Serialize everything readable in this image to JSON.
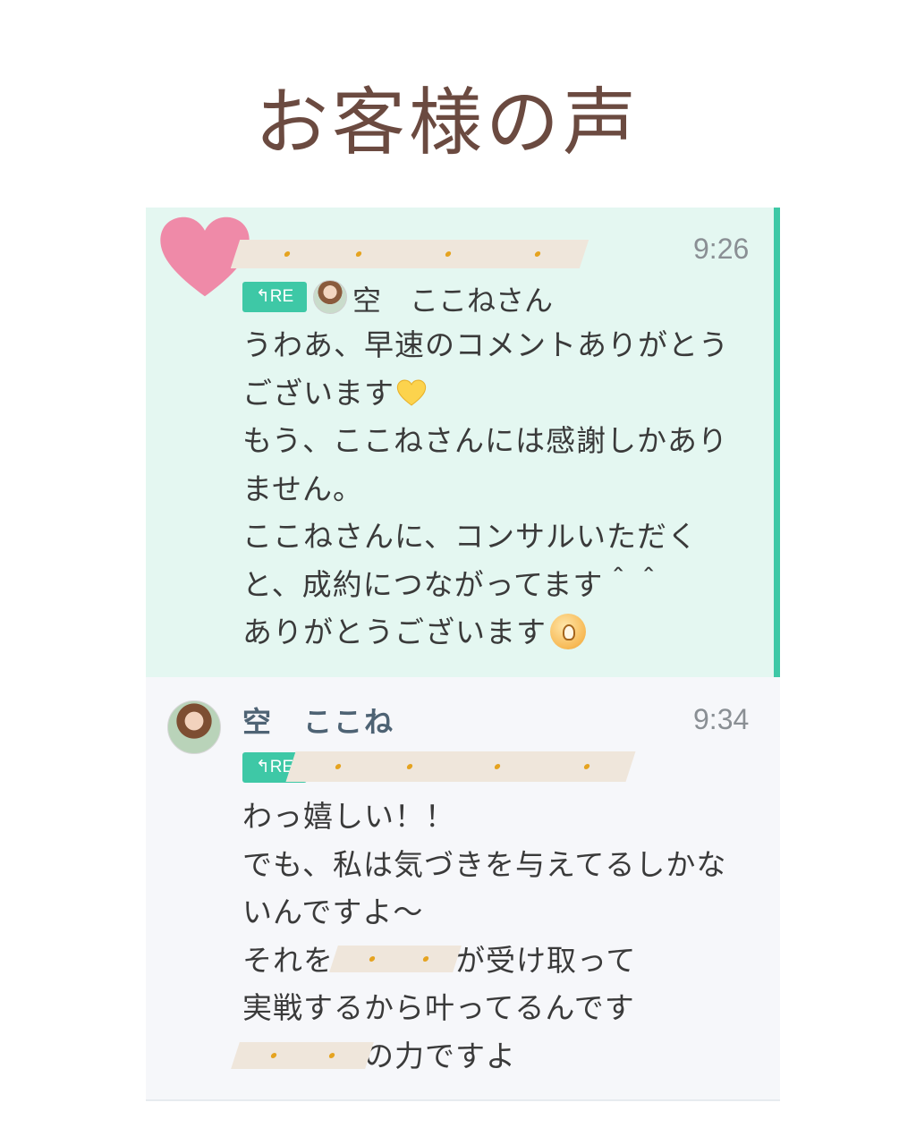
{
  "page_title": "お客様の声",
  "messages": [
    {
      "time": "9:26",
      "reply_badge": "↰RE",
      "reply_to_name": "空　ここねさん",
      "lines": [
        "うわあ、早速のコメントありがとう",
        "ございます",
        "もう、ここねさんには感謝しかあり",
        "ません。",
        "ここねさんに、コンサルいただく",
        "と、成約につながってます＾＾",
        "ありがとうございます"
      ]
    },
    {
      "sender_name": "空　ここね",
      "time": "9:34",
      "reply_badge": "↰RE",
      "lines": [
        "わっ嬉しい！！",
        "でも、私は気づきを与えてるしかな",
        "いんですよ〜",
        "それを　　　　が受け取って",
        "実戦するから叶ってるんです",
        "　　　　の力ですよ"
      ]
    }
  ],
  "colors": {
    "accent": "#3ec8a6",
    "highlight_bg": "#e4f7f1",
    "title": "#6b4a40"
  }
}
